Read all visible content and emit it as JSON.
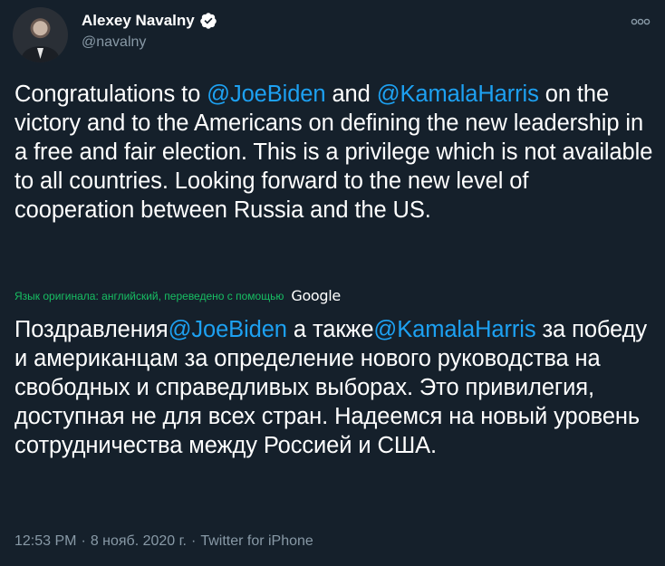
{
  "author": {
    "display_name": "Alexey Navalny",
    "handle": "@navalny"
  },
  "icons": {
    "verified": "verified-badge-icon",
    "more": "more-options-icon",
    "avatar": "avatar"
  },
  "colors": {
    "background": "#15202b",
    "link": "#1da1f2",
    "muted": "#8899a6",
    "translation_note": "#17bf63"
  },
  "tweet": {
    "original": {
      "t1": "Congratulations to ",
      "m1": "@JoeBiden",
      "t2": " and ",
      "m2": "@KamalaHarris",
      "t3": " on the victory and to the Americans on defining the new leadership in a free and fair election. This is a privilege which is not available to all countries. Looking forward to the new level of cooperation between Russia and the US."
    },
    "translation_note": "Язык оригинала: английский, переведено с помощью",
    "translation_provider": "Google",
    "translated": {
      "t1": "Поздравления",
      "m1": "@JoeBiden",
      "t2": " а также",
      "m2": "@KamalaHarris",
      "t3": " за победу и американцам за определение нового руководства на свободных и справедливых выборах. Это привилегия, доступная не для всех стран. Надеемся на новый уровень сотрудничества между Россией и США."
    }
  },
  "meta": {
    "time": "12:53 PM",
    "separator": "·",
    "date": "8 нояб. 2020 г.",
    "source": "Twitter for iPhone"
  }
}
